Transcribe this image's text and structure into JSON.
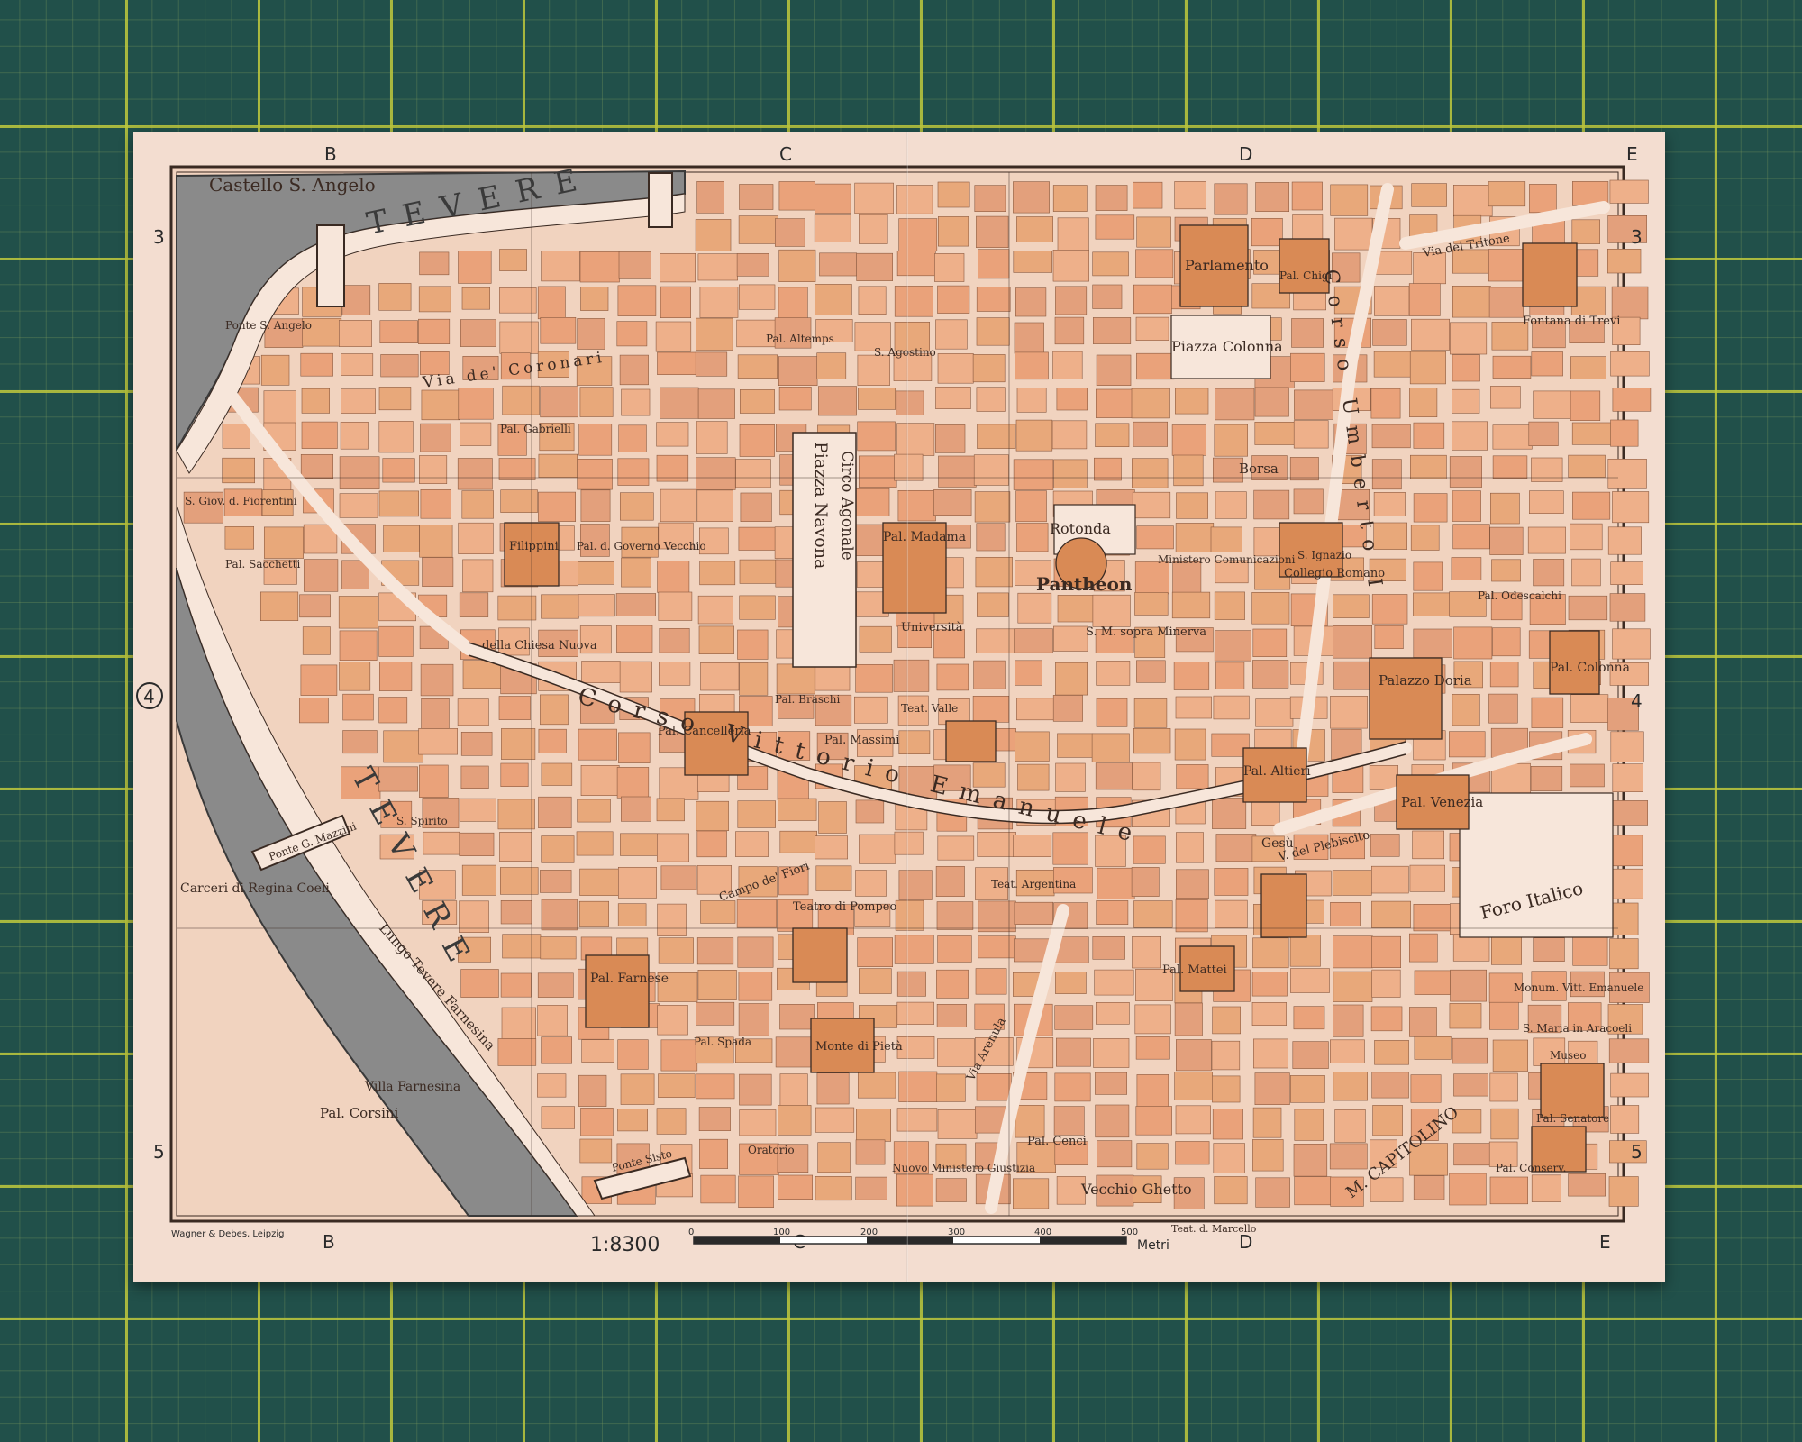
{
  "map": {
    "title_region": "Castello S. Angelo",
    "scale_text": "1:8300",
    "scale_unit": "Metri",
    "scale_ticks": [
      "0",
      "100",
      "200",
      "300",
      "400",
      "500"
    ],
    "publisher": "Wagner & Debes, Leipzig",
    "grid_columns": [
      "B",
      "C",
      "D",
      "E"
    ],
    "grid_rows": [
      "3",
      "4",
      "5"
    ],
    "river_name": "TEVERE",
    "colors": {
      "paper": "#f3ddd0",
      "building": "#e8a87a",
      "building_dark": "#d98a55",
      "water": "#7a7a7a",
      "mat": "#21504a",
      "mat_grid": "#bec83c"
    },
    "labels": {
      "castello": "Castello S. Angelo",
      "pantheon": "Pantheon",
      "piazza_navona": "Piazza Navona",
      "circo_agonale": "Circo Agonale",
      "parlamento": "Parlamento",
      "piazza_colonna": "Piazza Colonna",
      "pal_madama": "Pal. Madama",
      "pal_farnese": "Pal. Farnese",
      "pal_venezia": "Pal. Venezia",
      "pal_corsini": "Pal. Corsini",
      "villa_farnesina": "Villa Farnesina",
      "foro_italico": "Foro Italico",
      "m_capitolino": "M. CAPITOLINO",
      "vecchio_ghetto": "Vecchio Ghetto",
      "corso_vittorio": "Corso Vittorio Emanuele",
      "corso_umberto": "Corso Umberto I",
      "pal_doria": "Palazzo Doria",
      "pal_altieri": "Pal. Altieri",
      "borsa": "Borsa",
      "gesu": "Gesù",
      "carceri": "Carceri di Regina Coeli",
      "lungo_tevere": "Lungo Tevere Farnesina",
      "via_coronari": "Via de' Coronari",
      "ponte_mazzini": "Ponte G. Mazzini",
      "pal_colonna": "Pal. Colonna",
      "fontana_trevi": "Fontana di Trevi",
      "rotonda": "Rotonda",
      "minerva": "S. M. sopra Minerva",
      "collegio_romano": "Collegio Romano",
      "teatro_pompeo": "Teatro di Pompeo",
      "monte_pieta": "Monte di Pietà",
      "pal_cancelleria": "Pal. Cancelleria",
      "filippini": "Filippini",
      "chiesa_nuova": "della Chiesa Nuova",
      "pal_massimi": "Pal. Massimi",
      "sapienza": "Università",
      "pal_mattei": "Pal. Mattei",
      "pal_cenci": "Pal. Cenci",
      "campo_fiori": "Campo de' Fiori",
      "arenula": "Via Arenula",
      "plebiscito": "V. del Plebiscito",
      "tritone": "Via del Tritone",
      "pal_chigi": "Pal. Chigi",
      "pal_sacchetti": "Pal. Sacchetti",
      "pal_spada": "Pal. Spada",
      "teatro_valle": "Teat. Valle",
      "teatro_argentina": "Teat. Argentina",
      "pal_odescalchi": "Pal. Odescalchi",
      "monum": "Monum. Vitt. Emanuele",
      "museo": "Museo",
      "senatore": "Pal. Senatore",
      "conserv": "Pal. Conserv.",
      "aracoeli": "S. Maria in Aracoeli",
      "teat_marcello": "Teat. d. Marcello",
      "pal_gabrielli": "Pal. Gabrielli",
      "s_agostino": "S. Agostino",
      "pal_altemps": "Pal. Altemps",
      "s_ignazio": "S. Ignazio",
      "pal_braschi": "Pal. Braschi",
      "ponte_sisto": "Ponte Sisto",
      "ponte_s_angelo": "Ponte S. Angelo",
      "pal_governo": "Pal. d. Governo Vecchio",
      "ministero": "Ministero Comunicazioni",
      "nuovo_ministero": "Nuovo Ministero Giustizia",
      "oratorio": "Oratorio",
      "s_spirito": "S. Spirito",
      "s_giov_fiorentini": "S. Giov. d. Fiorentini"
    }
  }
}
